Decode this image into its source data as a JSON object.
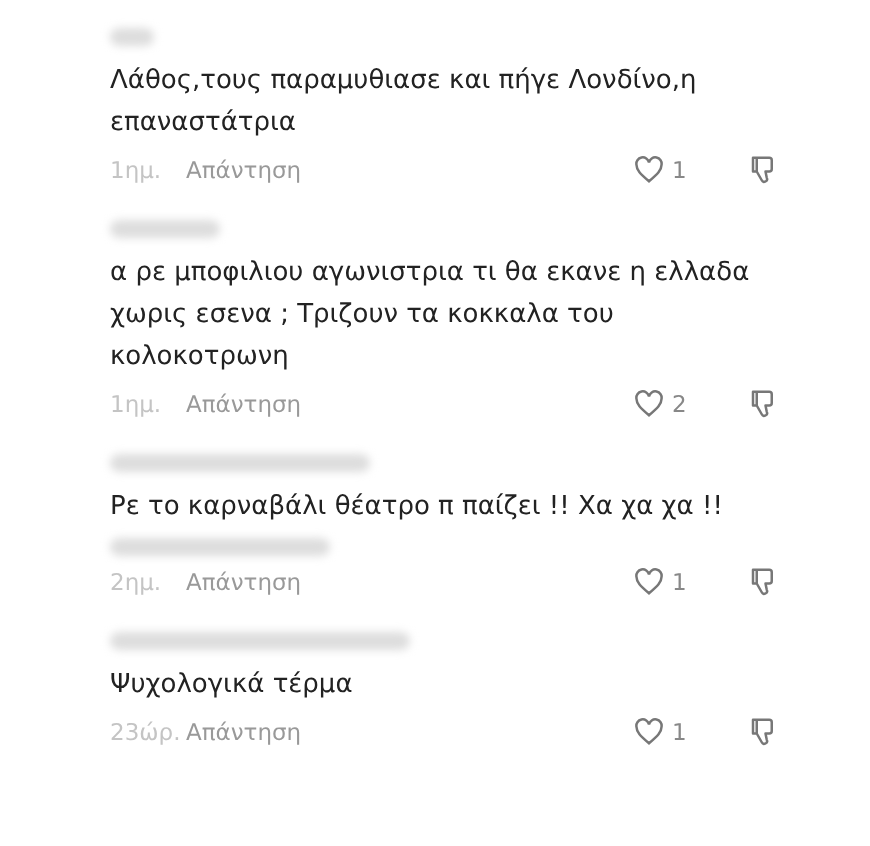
{
  "comments": [
    {
      "text": "Λάθος,τους παραμυθιασε και πήγε Λονδίνο,η επαναστάτρια",
      "extra_blur": false,
      "time": "1ημ.",
      "reply": "Απάντηση",
      "likes": "1"
    },
    {
      "text": "α ρε μποφιλιου αγωνιστρια τι θα εκανε η ελλαδα χωρις εσενα ; Τριζουν τα κοκκαλα του κολοκοτρωνη",
      "extra_blur": false,
      "time": "1ημ.",
      "reply": "Απάντηση",
      "likes": "2"
    },
    {
      "text": "Ρε το καρναβάλι θέατρο π παίζει !! Χα χα χα !!",
      "extra_blur": true,
      "time": "2ημ.",
      "reply": "Απάντηση",
      "likes": "1"
    },
    {
      "text": "Ψυχολογικά τέρμα",
      "extra_blur": false,
      "time": "23ώρ.",
      "reply": "Απάντηση",
      "likes": "1"
    }
  ]
}
